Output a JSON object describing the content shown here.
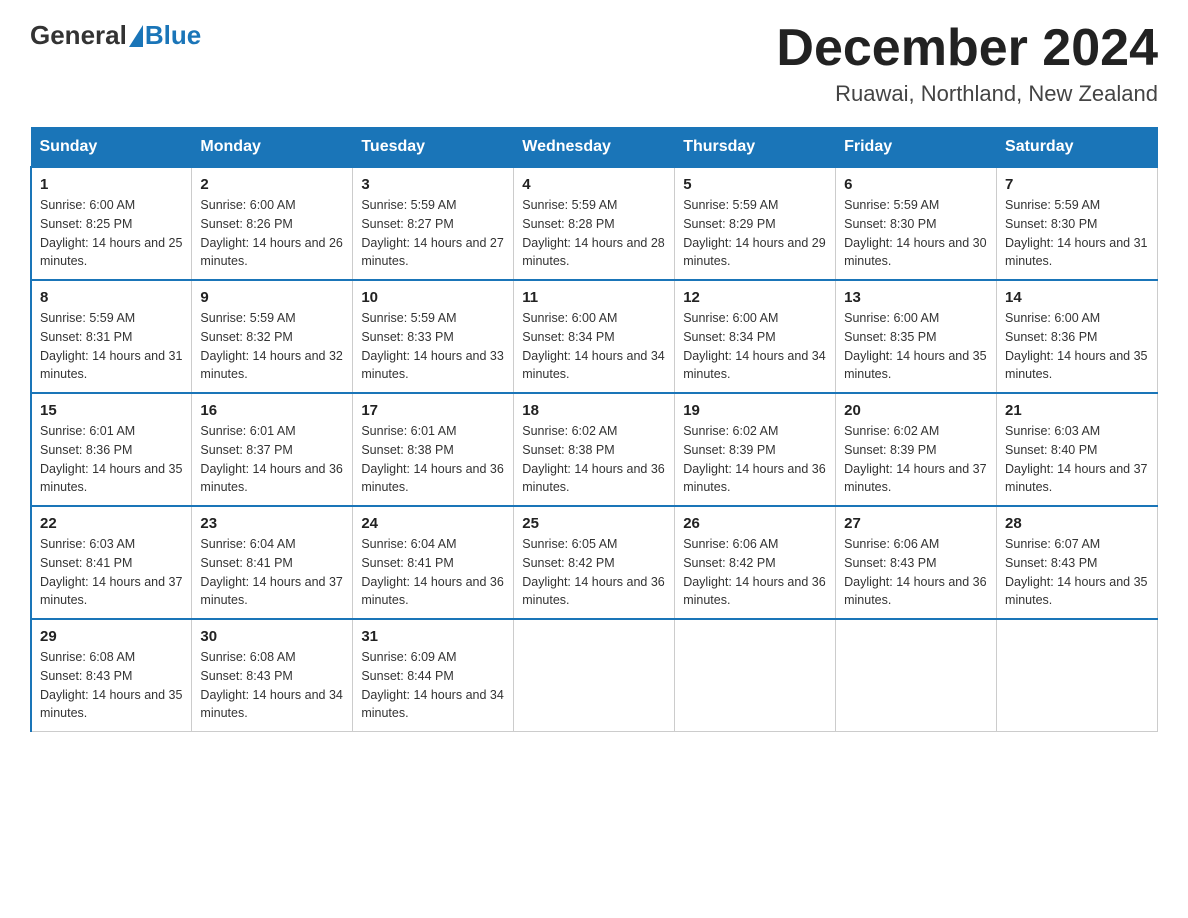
{
  "logo": {
    "general": "General",
    "blue": "Blue"
  },
  "title": "December 2024",
  "location": "Ruawai, Northland, New Zealand",
  "weekdays": [
    "Sunday",
    "Monday",
    "Tuesday",
    "Wednesday",
    "Thursday",
    "Friday",
    "Saturday"
  ],
  "weeks": [
    [
      {
        "day": "1",
        "sunrise": "6:00 AM",
        "sunset": "8:25 PM",
        "daylight": "14 hours and 25 minutes."
      },
      {
        "day": "2",
        "sunrise": "6:00 AM",
        "sunset": "8:26 PM",
        "daylight": "14 hours and 26 minutes."
      },
      {
        "day": "3",
        "sunrise": "5:59 AM",
        "sunset": "8:27 PM",
        "daylight": "14 hours and 27 minutes."
      },
      {
        "day": "4",
        "sunrise": "5:59 AM",
        "sunset": "8:28 PM",
        "daylight": "14 hours and 28 minutes."
      },
      {
        "day": "5",
        "sunrise": "5:59 AM",
        "sunset": "8:29 PM",
        "daylight": "14 hours and 29 minutes."
      },
      {
        "day": "6",
        "sunrise": "5:59 AM",
        "sunset": "8:30 PM",
        "daylight": "14 hours and 30 minutes."
      },
      {
        "day": "7",
        "sunrise": "5:59 AM",
        "sunset": "8:30 PM",
        "daylight": "14 hours and 31 minutes."
      }
    ],
    [
      {
        "day": "8",
        "sunrise": "5:59 AM",
        "sunset": "8:31 PM",
        "daylight": "14 hours and 31 minutes."
      },
      {
        "day": "9",
        "sunrise": "5:59 AM",
        "sunset": "8:32 PM",
        "daylight": "14 hours and 32 minutes."
      },
      {
        "day": "10",
        "sunrise": "5:59 AM",
        "sunset": "8:33 PM",
        "daylight": "14 hours and 33 minutes."
      },
      {
        "day": "11",
        "sunrise": "6:00 AM",
        "sunset": "8:34 PM",
        "daylight": "14 hours and 34 minutes."
      },
      {
        "day": "12",
        "sunrise": "6:00 AM",
        "sunset": "8:34 PM",
        "daylight": "14 hours and 34 minutes."
      },
      {
        "day": "13",
        "sunrise": "6:00 AM",
        "sunset": "8:35 PM",
        "daylight": "14 hours and 35 minutes."
      },
      {
        "day": "14",
        "sunrise": "6:00 AM",
        "sunset": "8:36 PM",
        "daylight": "14 hours and 35 minutes."
      }
    ],
    [
      {
        "day": "15",
        "sunrise": "6:01 AM",
        "sunset": "8:36 PM",
        "daylight": "14 hours and 35 minutes."
      },
      {
        "day": "16",
        "sunrise": "6:01 AM",
        "sunset": "8:37 PM",
        "daylight": "14 hours and 36 minutes."
      },
      {
        "day": "17",
        "sunrise": "6:01 AM",
        "sunset": "8:38 PM",
        "daylight": "14 hours and 36 minutes."
      },
      {
        "day": "18",
        "sunrise": "6:02 AM",
        "sunset": "8:38 PM",
        "daylight": "14 hours and 36 minutes."
      },
      {
        "day": "19",
        "sunrise": "6:02 AM",
        "sunset": "8:39 PM",
        "daylight": "14 hours and 36 minutes."
      },
      {
        "day": "20",
        "sunrise": "6:02 AM",
        "sunset": "8:39 PM",
        "daylight": "14 hours and 37 minutes."
      },
      {
        "day": "21",
        "sunrise": "6:03 AM",
        "sunset": "8:40 PM",
        "daylight": "14 hours and 37 minutes."
      }
    ],
    [
      {
        "day": "22",
        "sunrise": "6:03 AM",
        "sunset": "8:41 PM",
        "daylight": "14 hours and 37 minutes."
      },
      {
        "day": "23",
        "sunrise": "6:04 AM",
        "sunset": "8:41 PM",
        "daylight": "14 hours and 37 minutes."
      },
      {
        "day": "24",
        "sunrise": "6:04 AM",
        "sunset": "8:41 PM",
        "daylight": "14 hours and 36 minutes."
      },
      {
        "day": "25",
        "sunrise": "6:05 AM",
        "sunset": "8:42 PM",
        "daylight": "14 hours and 36 minutes."
      },
      {
        "day": "26",
        "sunrise": "6:06 AM",
        "sunset": "8:42 PM",
        "daylight": "14 hours and 36 minutes."
      },
      {
        "day": "27",
        "sunrise": "6:06 AM",
        "sunset": "8:43 PM",
        "daylight": "14 hours and 36 minutes."
      },
      {
        "day": "28",
        "sunrise": "6:07 AM",
        "sunset": "8:43 PM",
        "daylight": "14 hours and 35 minutes."
      }
    ],
    [
      {
        "day": "29",
        "sunrise": "6:08 AM",
        "sunset": "8:43 PM",
        "daylight": "14 hours and 35 minutes."
      },
      {
        "day": "30",
        "sunrise": "6:08 AM",
        "sunset": "8:43 PM",
        "daylight": "14 hours and 34 minutes."
      },
      {
        "day": "31",
        "sunrise": "6:09 AM",
        "sunset": "8:44 PM",
        "daylight": "14 hours and 34 minutes."
      },
      null,
      null,
      null,
      null
    ]
  ]
}
